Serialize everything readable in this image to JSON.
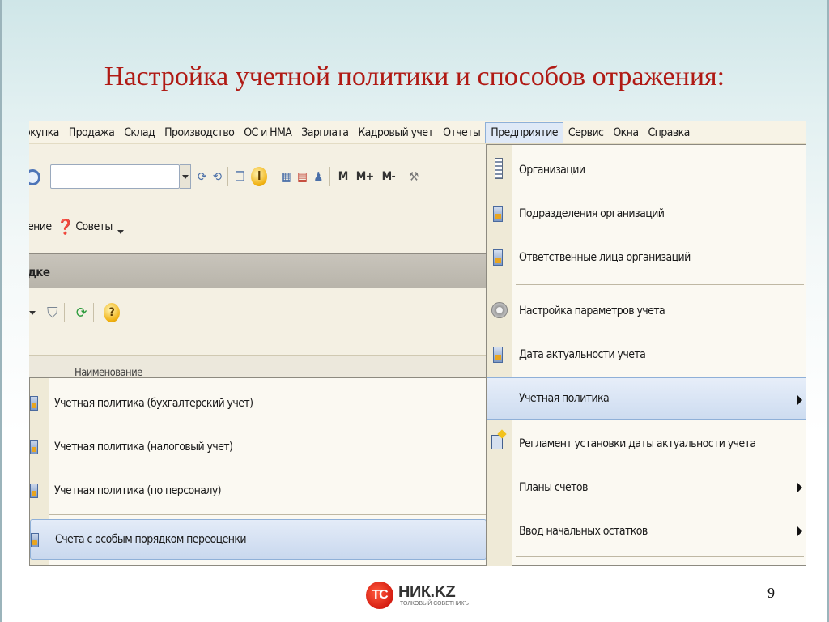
{
  "slide": {
    "title": "Настройка учетной политики и способов отражения:",
    "page_number": "9"
  },
  "menubar": {
    "items": [
      {
        "label": "Покупка",
        "visible_text": "окупка"
      },
      {
        "label": "Продажа"
      },
      {
        "label": "Склад"
      },
      {
        "label": "Производство"
      },
      {
        "label": "ОС и НМА"
      },
      {
        "label": "Зарплата"
      },
      {
        "label": "Кадровый учет"
      },
      {
        "label": "Отчеты"
      },
      {
        "label": "Предприятие"
      },
      {
        "label": "Сервис"
      },
      {
        "label": "Окна"
      },
      {
        "label": "Справка"
      }
    ],
    "active": "Предприятие"
  },
  "toolbar": {
    "m_label": "M",
    "mplus_label": "M+",
    "mminus_label": "M-",
    "search_value": ""
  },
  "toolbar2": {
    "partial_label": "ение",
    "tips_label": "Советы"
  },
  "panel": {
    "header_partial": "дке"
  },
  "grid": {
    "column_label": "Наименование"
  },
  "enterprise_menu": {
    "items": [
      {
        "label": "Организации",
        "icon": "building-icon"
      },
      {
        "label": "Подразделения организаций",
        "icon": "document-icon"
      },
      {
        "label": "Ответственные лица организаций",
        "icon": "document-icon"
      },
      {
        "label": "Настройка параметров учета",
        "icon": "gear-icon"
      },
      {
        "label": "Дата актуальности учета",
        "icon": "document-icon"
      },
      {
        "label": "Учетная политика",
        "icon": "",
        "submenu": true,
        "highlighted": true
      },
      {
        "label": "Регламент установки даты актуальности учета",
        "icon": "regulation-icon"
      },
      {
        "label": "Планы счетов",
        "icon": "",
        "submenu": true
      },
      {
        "label": "Ввод начальных остатков",
        "icon": "",
        "submenu": true
      }
    ]
  },
  "policy_submenu": {
    "items": [
      {
        "label": "Учетная политика (бухгалтерский учет)",
        "icon": "document-icon"
      },
      {
        "label": "Учетная политика (налоговый учет)",
        "icon": "document-icon"
      },
      {
        "label": "Учетная политика (по персоналу)",
        "icon": "document-icon"
      },
      {
        "label": "Счета с особым порядком переоценки",
        "icon": "document-icon",
        "highlighted": true
      }
    ]
  },
  "logo": {
    "mark": "ТС",
    "word": "НИК.KZ",
    "tagline": "ТОЛКОВЫЙ СОВЕТНИКЪ"
  },
  "colors": {
    "title_red": "#b01a14",
    "highlight_blue": "#cddcf0",
    "menu_bg": "#fbf9f2"
  }
}
